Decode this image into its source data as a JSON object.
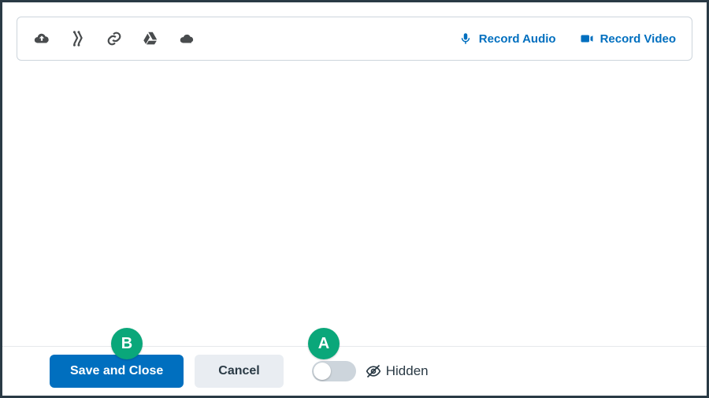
{
  "toolbar": {
    "record_audio": "Record Audio",
    "record_video": "Record Video"
  },
  "footer": {
    "save_close": "Save and Close",
    "cancel": "Cancel",
    "visibility_label": "Hidden"
  },
  "callouts": {
    "a": "A",
    "b": "B"
  },
  "colors": {
    "primary": "#006fbf",
    "callout": "#0aa77a",
    "icon": "#494C4E"
  }
}
